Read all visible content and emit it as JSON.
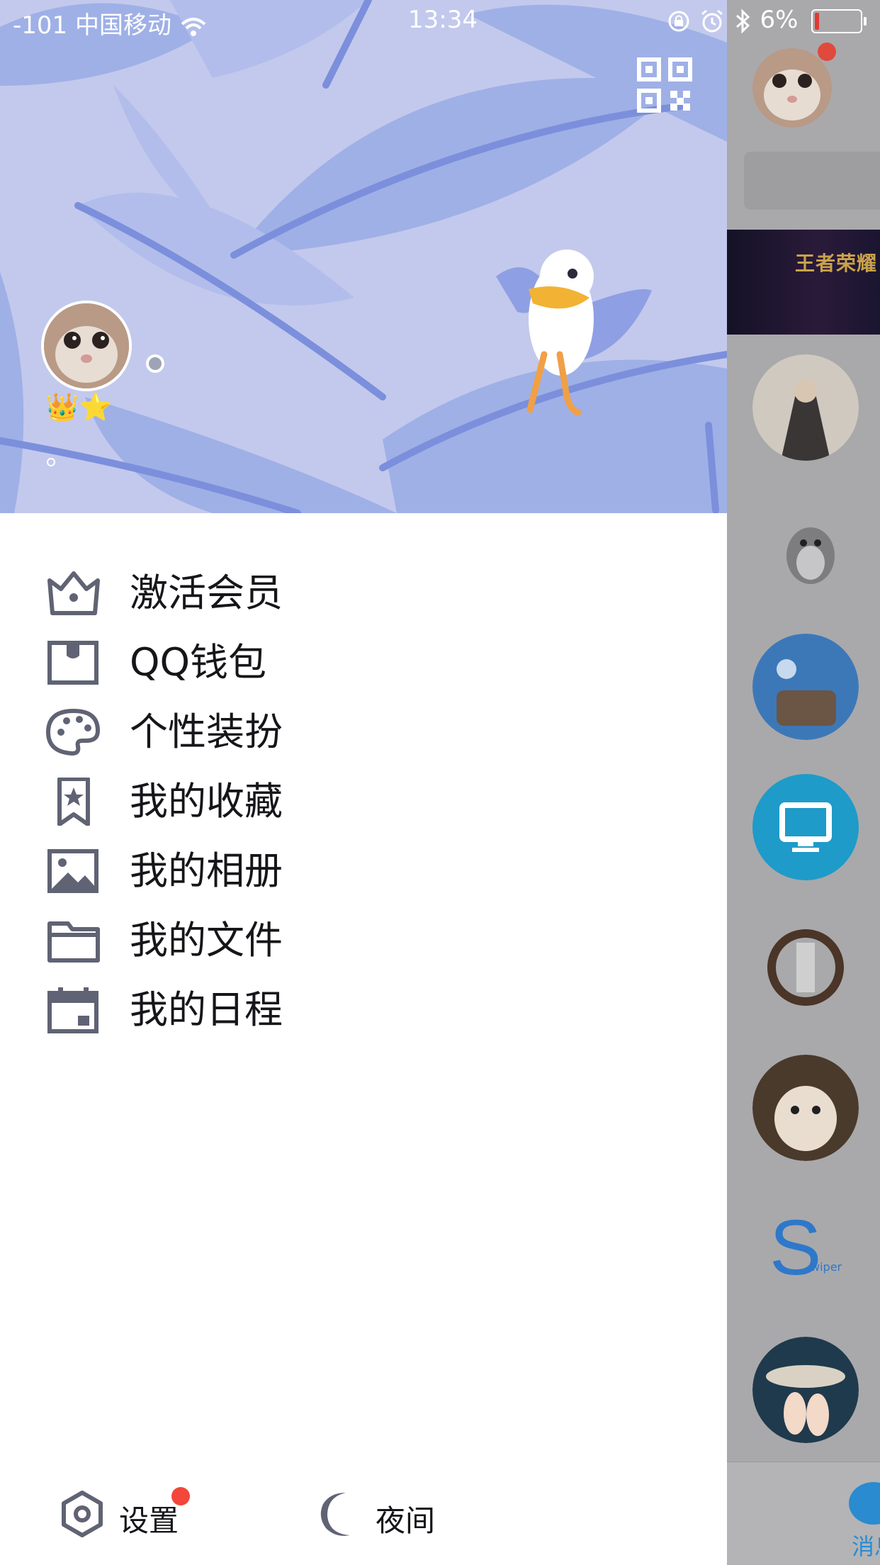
{
  "status_bar": {
    "carrier": "-101 中国移动",
    "time": "13:34",
    "battery": "6%"
  },
  "header": {
    "qr_icon": "qr-code-icon",
    "avatar_icon": "cat-avatar",
    "vip_icons": [
      "crown-icon",
      "star-icon"
    ],
    "vip_glyphs": "👑⭐"
  },
  "menu": {
    "items": [
      {
        "label": "激活会员",
        "icon": "crown-outline-icon"
      },
      {
        "label": "QQ钱包",
        "icon": "wallet-icon"
      },
      {
        "label": "个性装扮",
        "icon": "palette-icon"
      },
      {
        "label": "我的收藏",
        "icon": "bookmark-star-icon"
      },
      {
        "label": "我的相册",
        "icon": "picture-icon"
      },
      {
        "label": "我的文件",
        "icon": "folder-icon"
      },
      {
        "label": "我的日程",
        "icon": "calendar-icon"
      }
    ]
  },
  "footer": {
    "settings_label": "设置",
    "night_label": "夜间"
  },
  "background": {
    "banner_text": "王者荣耀",
    "swiper_letter": "S",
    "swiper_text": "wiper",
    "tab_label": "消息"
  },
  "colors": {
    "icon": "#5f6373",
    "text": "#16161a",
    "header_bg": "#c3c9ec",
    "badge_red": "#f2473a",
    "accent_blue": "#2a8bd0"
  }
}
